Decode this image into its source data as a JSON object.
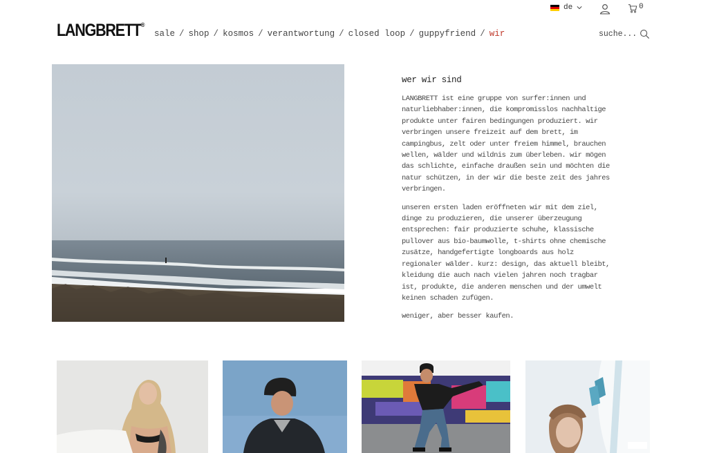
{
  "utility": {
    "language": "de",
    "cart_count": "0"
  },
  "header": {
    "logo": "LANGBRETT",
    "logo_mark": "®",
    "search_label": "suche..."
  },
  "nav": {
    "items": [
      {
        "label": "sale"
      },
      {
        "label": "shop"
      },
      {
        "label": "kosmos"
      },
      {
        "label": "verantwortung"
      },
      {
        "label": "closed loop"
      },
      {
        "label": "guppyfriend"
      },
      {
        "label": "wir"
      }
    ],
    "separator": "/",
    "active_color": "#c0392b"
  },
  "about": {
    "heading": "wer wir sind",
    "paragraphs": [
      "LANGBRETT ist eine gruppe von surfer:innen und naturliebhaber:innen, die kompromisslos nachhaltige produkte unter fairen bedingungen produziert. wir verbringen unsere freizeit auf dem brett, im campingbus, zelt oder unter freiem himmel, brauchen wellen, wälder und wildnis zum überleben. wir mögen das schlichte, einfache draußen sein und möchten die natur schützen, in der wir die beste zeit des jahres verbringen.",
      "unseren ersten laden eröffneten wir mit dem ziel, dinge zu produzieren, die unserer überzeugung entsprechen: fair produzierte schuhe, klassische pullover aus bio-baumwolle, t-shirts ohne chemische zusätze, handgefertigte longboards aus holz regionaler wälder. kurz: design, das aktuell bleibt, kleidung die auch nach vielen jahren noch tragbar ist, produkte, die anderen menschen und der umwelt keinen schaden zufügen.",
      "weniger, aber besser kaufen."
    ]
  },
  "icons": [
    "germany-flag-icon",
    "chevron-down-icon",
    "user-icon",
    "cart-icon",
    "search-icon"
  ]
}
